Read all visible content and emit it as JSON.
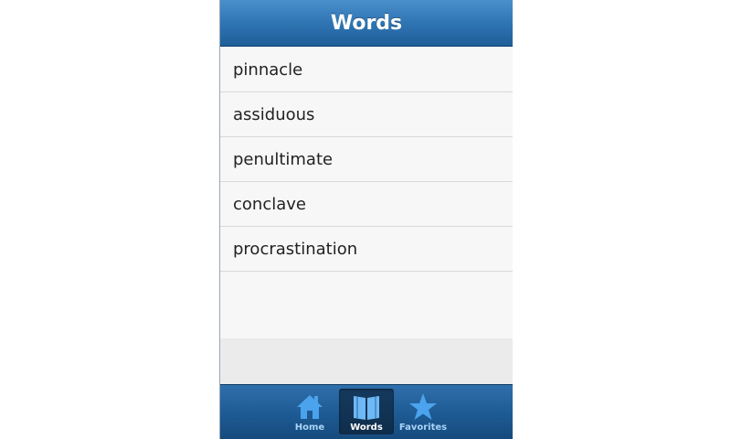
{
  "header": {
    "title": "Words"
  },
  "words": [
    "pinnacle",
    "assiduous",
    "penultimate",
    "conclave",
    "procrastination"
  ],
  "tabs": [
    {
      "label": "Home",
      "icon": "home-icon",
      "active": false
    },
    {
      "label": "Words",
      "icon": "book-icon",
      "active": true
    },
    {
      "label": "Favorites",
      "icon": "star-icon",
      "active": false
    }
  ],
  "colors": {
    "header_blue": "#2f75b4",
    "tabbar_blue": "#1d5a93",
    "icon_blue": "#4aa3ec",
    "active_label": "#ffffff",
    "inactive_label": "#a9d3f7"
  }
}
